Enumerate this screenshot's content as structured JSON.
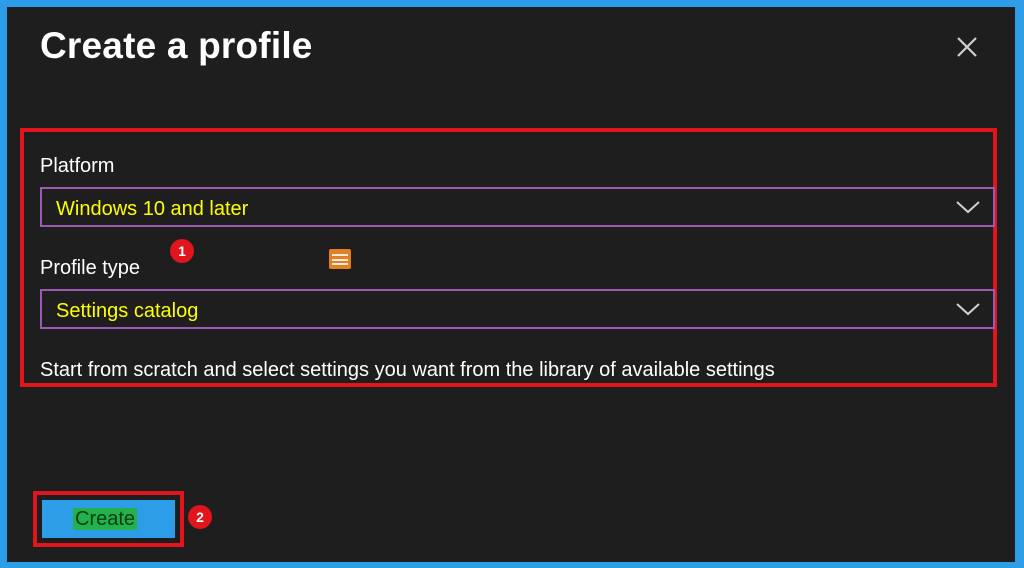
{
  "dialog": {
    "title": "Create a profile",
    "close_icon": "close-icon"
  },
  "form": {
    "platform": {
      "label": "Platform",
      "value": "Windows 10 and later",
      "icon": "chevron-down-icon"
    },
    "profile_type": {
      "label": "Profile type",
      "value": "Settings catalog",
      "icon": "chevron-down-icon"
    },
    "description": "Start from scratch and select settings you want from the library of available settings"
  },
  "annotations": {
    "step1": "1",
    "step2": "2"
  },
  "actions": {
    "create_label": "Create"
  },
  "colors": {
    "outer_border": "#2d9de8",
    "panel_background": "#1e1e1e",
    "highlight_border": "#e2151c",
    "select_border": "#9b59b6",
    "select_text": "#ffff00",
    "button_background": "#2d9de8",
    "button_label_highlight": "#22b14c"
  }
}
